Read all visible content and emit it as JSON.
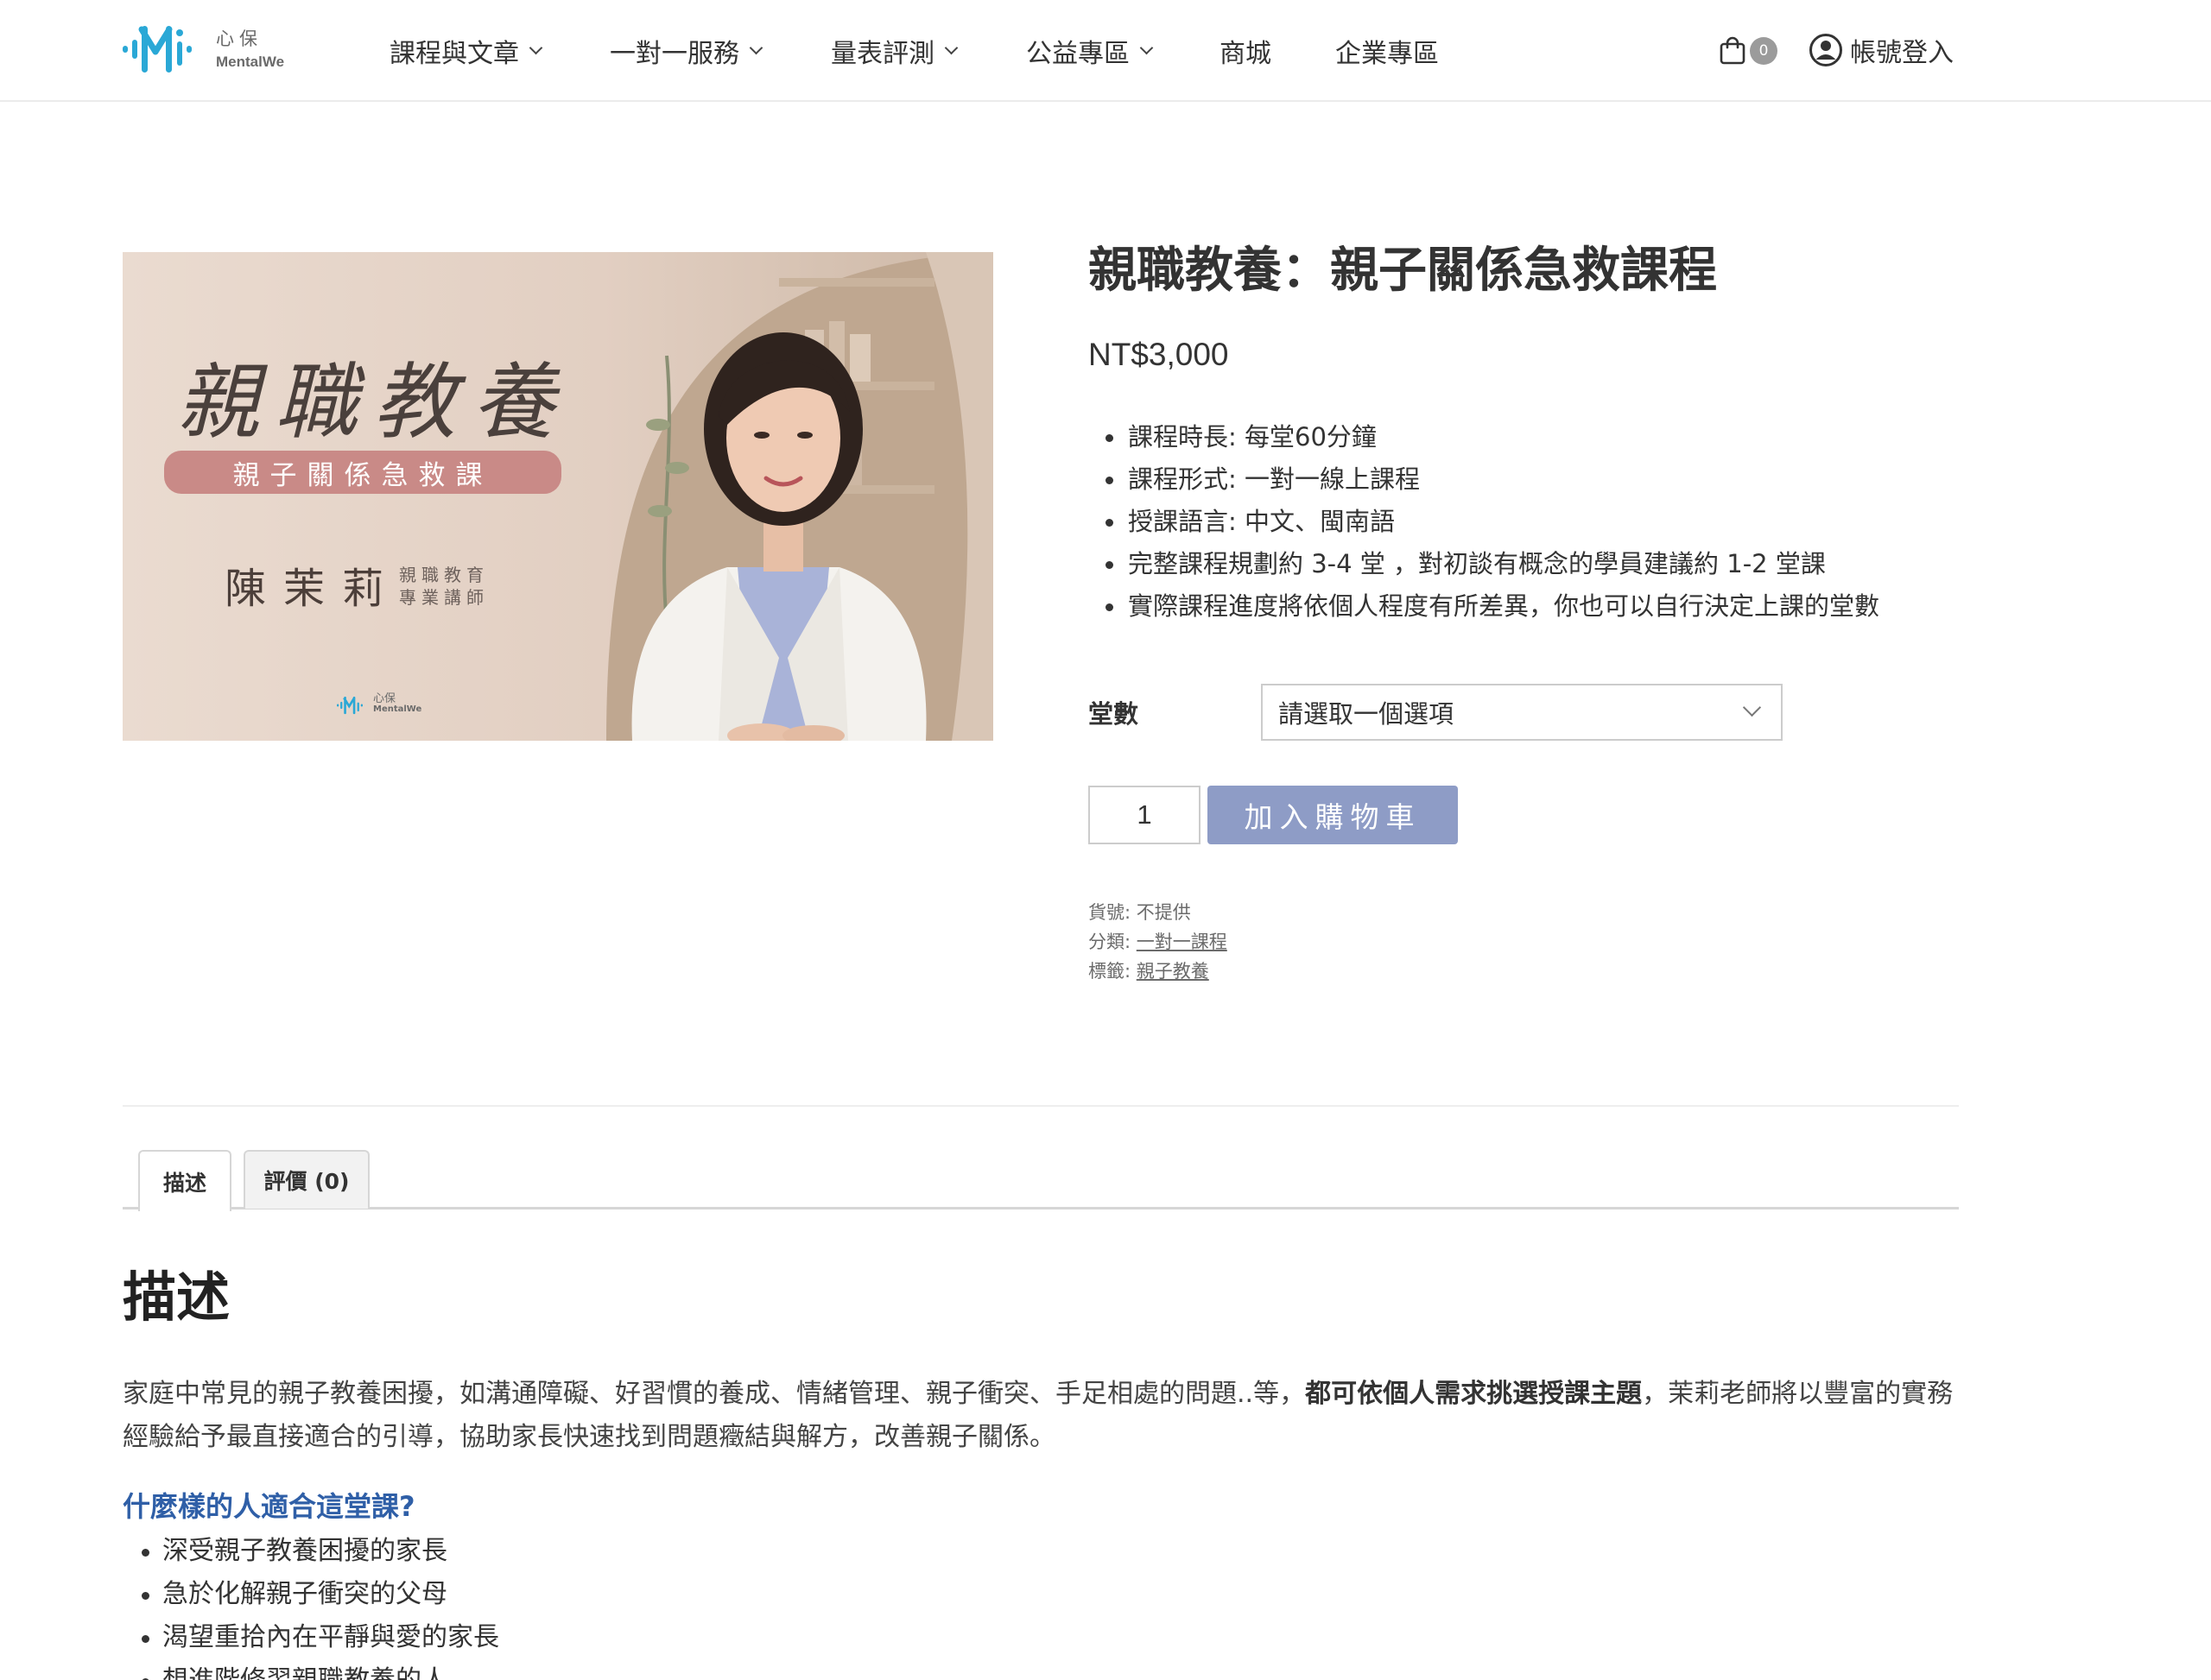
{
  "header": {
    "logo": {
      "cn": "心保",
      "en": "MentalWe"
    },
    "nav": [
      {
        "label": "課程與文章",
        "dropdown": true
      },
      {
        "label": "一對一服務",
        "dropdown": true
      },
      {
        "label": "量表評測",
        "dropdown": true
      },
      {
        "label": "公益專區",
        "dropdown": true
      },
      {
        "label": "商城",
        "dropdown": false
      },
      {
        "label": "企業專區",
        "dropdown": false
      }
    ],
    "cart_count": "0",
    "login_label": "帳號登入"
  },
  "banner": {
    "title_calligraphy": "親職教養",
    "subtitle": "親子關係急救課",
    "teacher_name": "陳茉莉",
    "teacher_role_line1": "親職教育",
    "teacher_role_line2": "專業講師",
    "logo_cn": "心保",
    "logo_en": "MentalWe"
  },
  "product": {
    "title": "親職教養：親子關係急救課程",
    "price": "NT$3,000",
    "features": [
      "課程時長: 每堂60分鐘",
      "課程形式: 一對一線上課程",
      "授課語言: 中文、閩南語",
      "完整課程規劃約 3-4 堂 ，對初談有概念的學員建議約 1-2 堂課",
      "實際課程進度將依個人程度有所差異，你也可以自行決定上課的堂數"
    ],
    "variation_label": "堂數",
    "variation_placeholder": "請選取一個選項",
    "quantity": "1",
    "add_to_cart": "加入購物車",
    "meta": {
      "sku_label": "貨號:",
      "sku_value": "不提供",
      "category_label": "分類:",
      "category_value": "一對一課程",
      "tag_label": "標籤:",
      "tag_value": "親子教養"
    }
  },
  "tabs": [
    {
      "label": "描述",
      "active": true
    },
    {
      "label": "評價 (0)",
      "active": false
    }
  ],
  "description": {
    "heading": "描述",
    "para_part1": "家庭中常見的親子教養困擾，如溝通障礙、好習慣的養成、情緒管理、親子衝突、手足相處的問題..等，",
    "para_bold": "都可依個人需求挑選授課主題",
    "para_part2": "，茉莉老師將以豐富的實務經驗給予最直接適合的引導，協助家長快速找到問題癥結與解方，改善親子關係。",
    "audience_heading": "什麼樣的人適合這堂課?",
    "audience": [
      "深受親子教養困擾的家長",
      "急於化解親子衝突的父母",
      "渴望重拾內在平靜與愛的家長",
      "想進階修習親職教養的人"
    ]
  },
  "colors": {
    "accent_button": "#8e9cc6",
    "link_blue": "#2f5fa7",
    "logo_blue": "#2aa8d6",
    "banner_bar": "#c98a87"
  }
}
